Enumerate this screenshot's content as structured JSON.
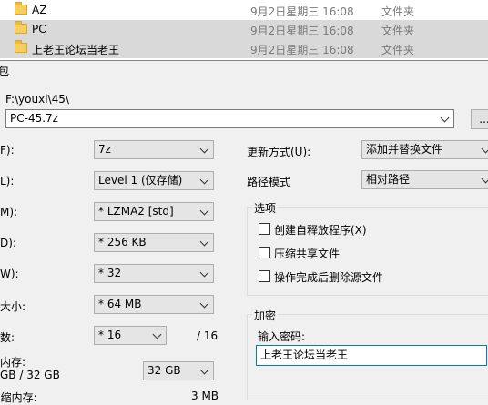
{
  "explorer": {
    "rows": [
      {
        "name": "AZ",
        "date": "9月2日星期三 16:08",
        "type": "文件夹"
      },
      {
        "name": "PC",
        "date": "9月2日星期三 16:08",
        "type": "文件夹"
      },
      {
        "name": "上老王论坛当老王",
        "date": "9月2日星期三 16:08",
        "type": "文件夹"
      }
    ]
  },
  "dialog": {
    "title_fragment": "包",
    "path": "F:\\youxi\\45\\",
    "archive_name": "PC-45.7z",
    "browse_label": "...",
    "left_labels": {
      "format": "F):",
      "level": "L):",
      "method": "M):",
      "dict": "D):",
      "word": "W):",
      "solid": "大小:",
      "threads": "数:",
      "memory": "内存:",
      "memory_value": "GB / 32 GB",
      "decompress_mem": "[缩内存:",
      "decompress_value": "3 MB"
    },
    "left_values": {
      "format": "7z",
      "level": "Level 1 (仅存储)",
      "method": "* LZMA2 [std]",
      "dict": "* 256 KB",
      "word": "* 32",
      "solid": "* 64 MB",
      "threads": "* 16",
      "threads_total": "/ 16",
      "memory_usage": "32 GB"
    },
    "update_mode_label": "更新方式(U):",
    "update_mode_value": "添加并替换文件",
    "path_mode_label": "路径模式",
    "path_mode_value": "相对路径",
    "options_title": "选项",
    "options": [
      {
        "label": "创建自释放程序(X)",
        "checked": false
      },
      {
        "label": "压缩共享文件",
        "checked": false
      },
      {
        "label": "操作完成后删除源文件",
        "checked": false
      }
    ],
    "encryption_title": "加密",
    "password_label": "输入密码:",
    "password_value": "上老王论坛当老王"
  }
}
